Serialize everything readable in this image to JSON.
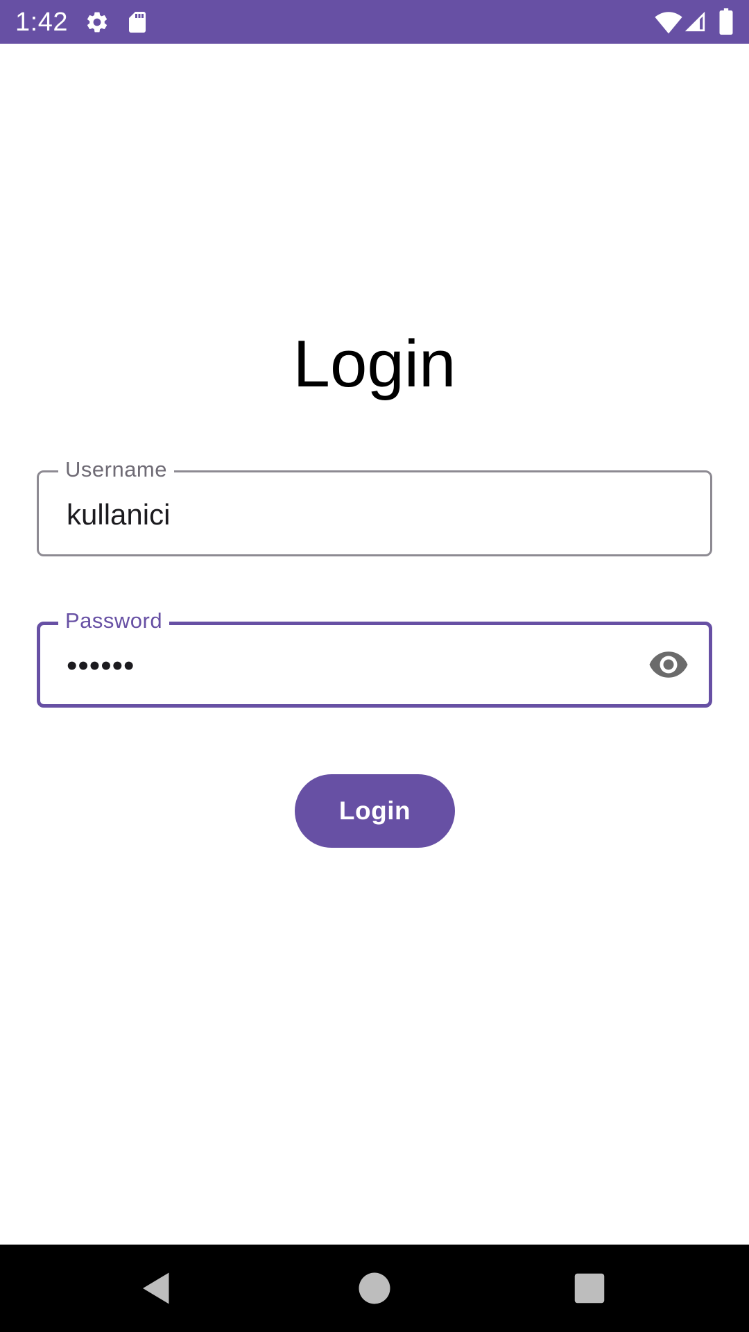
{
  "status_bar": {
    "time": "1:42",
    "background_color": "#6750a4",
    "icons_left": [
      "settings-gear-icon",
      "sd-card-icon"
    ],
    "icons_right": [
      "wifi-signal-icon",
      "cellular-signal-icon",
      "battery-icon"
    ]
  },
  "screen": {
    "title": "Login"
  },
  "form": {
    "username": {
      "label": "Username",
      "value": "kullanici"
    },
    "password": {
      "label": "Password",
      "value": "••••••",
      "visibility_icon": "eye-icon",
      "focused": true
    },
    "submit_label": "Login"
  },
  "colors": {
    "primary": "#6750a4",
    "outline": "#8d8a92",
    "label_unfocused": "#6f6b75",
    "text": "#1c1b1f",
    "background": "#ffffff"
  },
  "nav_bar": {
    "buttons": [
      "back-icon",
      "home-icon",
      "recents-icon"
    ]
  }
}
